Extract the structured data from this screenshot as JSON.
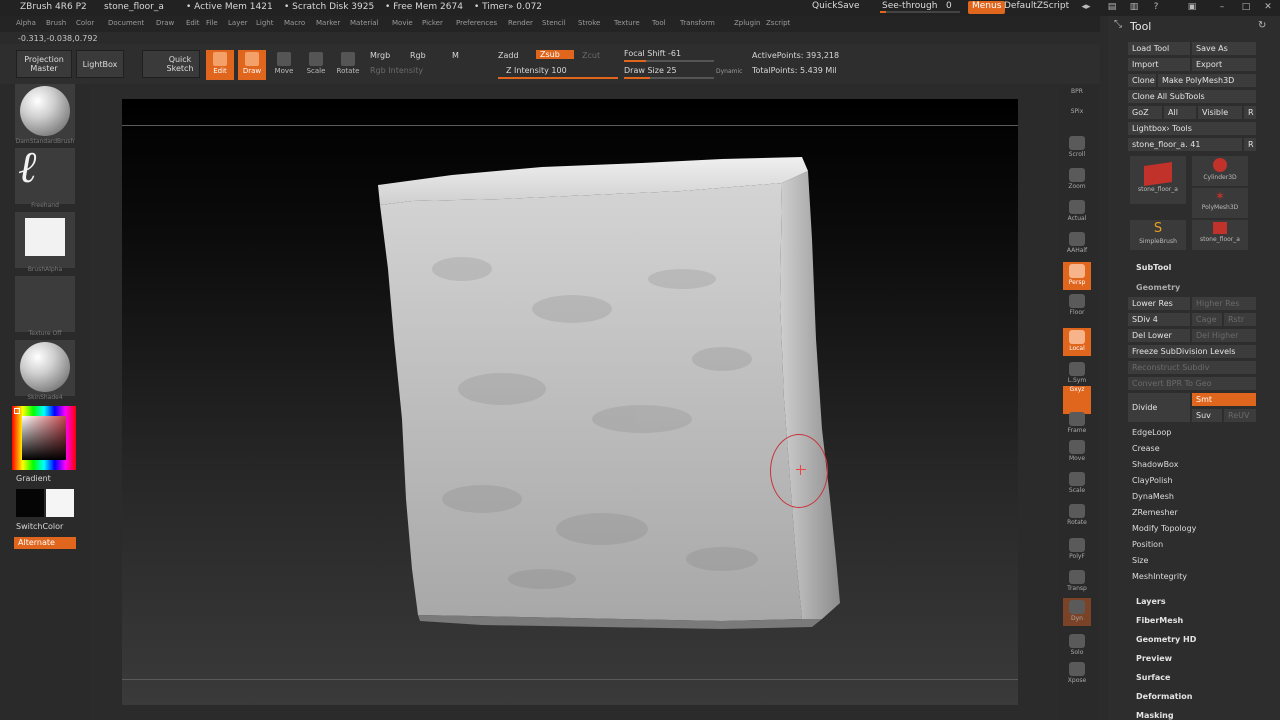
{
  "titlebar": {
    "app": "ZBrush 4R6 P2",
    "project": "stone_floor_a",
    "active_mem": "• Active Mem 1421",
    "scratch_disk": "• Scratch Disk 3925",
    "free_mem": "• Free Mem 2674",
    "timer": "• Timer» 0.072",
    "quicksave": "QuickSave",
    "seethrough_label": "See-through",
    "seethrough_value": "0",
    "menus": "Menus",
    "default_script": "DefaultZScript"
  },
  "menubar": {
    "items": [
      "Alpha",
      "Brush",
      "Color",
      "Document",
      "Draw",
      "Edit",
      "File",
      "Layer",
      "Light",
      "Macro",
      "Marker",
      "Material",
      "Movie",
      "Picker",
      "Preferences",
      "Render",
      "Stencil",
      "Stroke",
      "Texture",
      "Tool",
      "Transform",
      "Zplugin",
      "Zscript"
    ]
  },
  "coords": "-0.313,-0.038,0.792",
  "toolbar": {
    "projection_master": "Projection Master",
    "lightbox": "LightBox",
    "quick_sketch": "Quick Sketch",
    "edit": "Edit",
    "draw": "Draw",
    "move": "Move",
    "scale": "Scale",
    "rotate": "Rotate",
    "mrgb": "Mrgb",
    "rgb": "Rgb",
    "m": "M",
    "rgb_intensity": "Rgb Intensity",
    "zadd": "Zadd",
    "zsub": "Zsub",
    "zcut": "Zcut",
    "z_intensity": "Z Intensity 100",
    "focal_shift": "Focal Shift -61",
    "draw_size": "Draw Size 25",
    "dynamic": "Dynamic",
    "active_points": "ActivePoints: 393,218",
    "total_points": "TotalPoints: 5.439 Mil"
  },
  "leftpanel": {
    "brush_caption": "DamStandardBrush",
    "stroke_caption": "Freehand",
    "alpha_caption": "BrushAlpha",
    "texture_caption": "Texture Off",
    "material_caption": "SkinShade4",
    "gradient": "Gradient",
    "switchcolor": "SwitchColor",
    "alternate": "Alternate"
  },
  "rightshelf": {
    "buttons": [
      "BPR",
      "SPix",
      "Scroll",
      "Zoom",
      "Actual",
      "AAHalf",
      "Persp",
      "Floor",
      "Local",
      "L.Sym",
      "Gxyz",
      "Frame",
      "Move",
      "Scale",
      "Rotate",
      "PolyF",
      "Transp",
      "Dyn",
      "Solo",
      "Xpose"
    ],
    "spix_value": "3"
  },
  "toolpanel": {
    "title": "Tool",
    "load_tool": "Load Tool",
    "save_as": "Save As",
    "import": "Import",
    "export": "Export",
    "clone": "Clone",
    "make_polymesh": "Make PolyMesh3D",
    "clone_all": "Clone All SubTools",
    "goz": "GoZ",
    "all": "All",
    "visible": "Visible",
    "r": "R",
    "lightbox_tools": "Lightbox› Tools",
    "current_tool": "stone_floor_a. 41",
    "thumbs": [
      "stone_floor_a",
      "Cylinder3D",
      "PolyMesh3D",
      "SimpleBrush",
      "stone_floor_a"
    ],
    "subtool": "SubTool",
    "geometry": "Geometry",
    "lower_res": "Lower Res",
    "higher_res": "Higher Res",
    "sdiv": "SDiv 4",
    "cage": "Cage",
    "rstr": "Rstr",
    "del_lower": "Del Lower",
    "del_higher": "Del Higher",
    "freeze_subdivision": "Freeze SubDivision Levels",
    "reconstruct_subdiv": "Reconstruct Subdiv",
    "convert_bpr": "Convert BPR To Geo",
    "divide": "Divide",
    "smt": "Smt",
    "suv": "Suv",
    "reuv": "ReUV",
    "sections": [
      "EdgeLoop",
      "Crease",
      "ShadowBox",
      "ClayPolish",
      "DynaMesh",
      "ZRemesher",
      "Modify Topology",
      "Position",
      "Size",
      "MeshIntegrity"
    ],
    "groups": [
      "Layers",
      "FiberMesh",
      "Geometry HD",
      "Preview",
      "Surface",
      "Deformation",
      "Masking"
    ]
  },
  "colors": {
    "accent": "#e0651d",
    "panel": "#2d2d2d",
    "button": "#3c3c3c"
  }
}
